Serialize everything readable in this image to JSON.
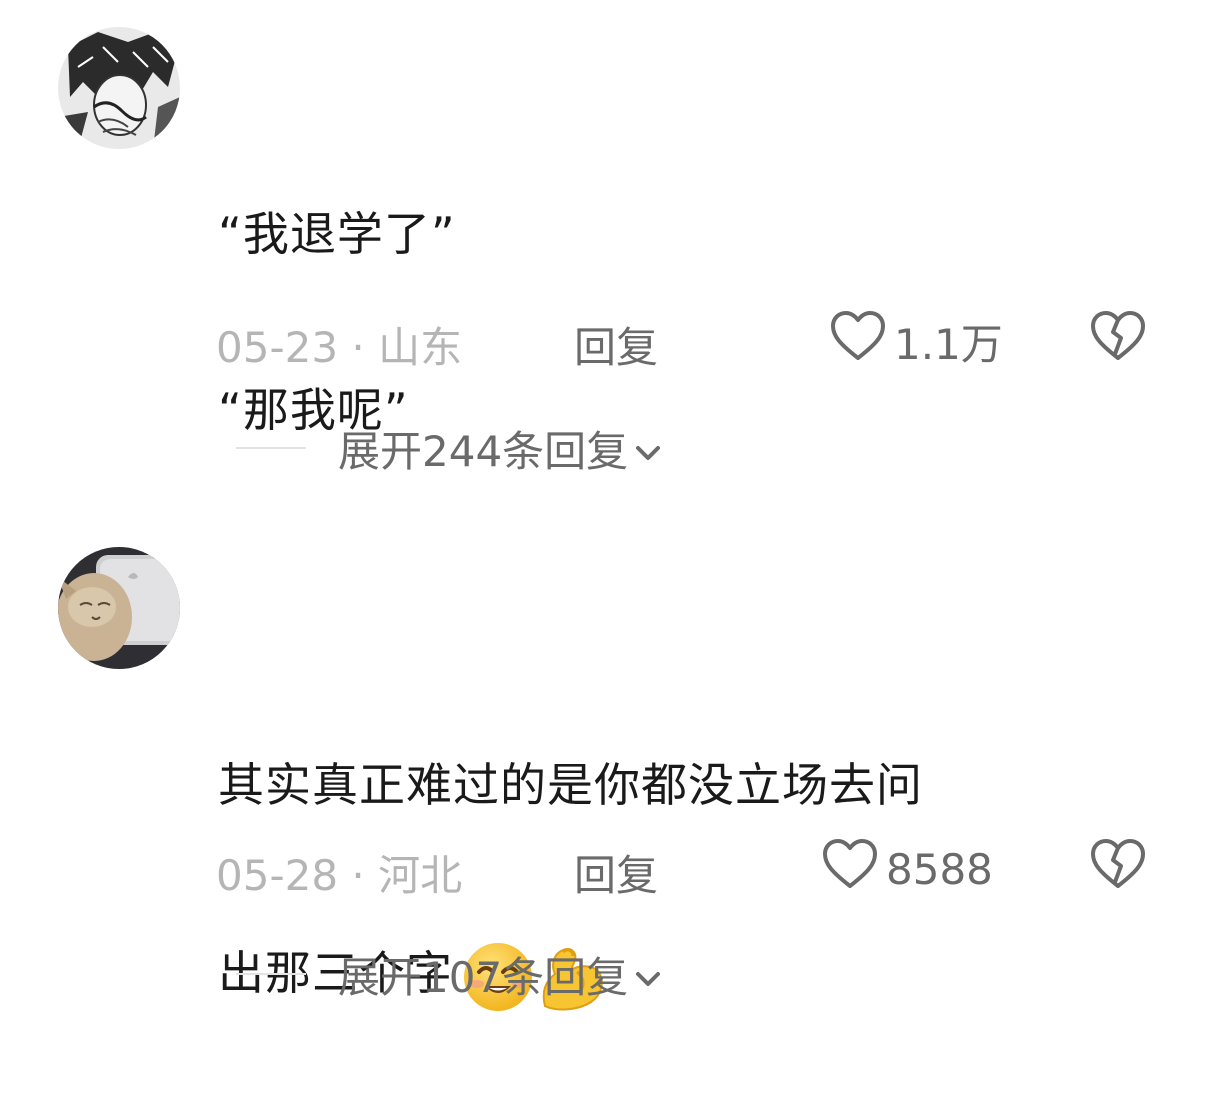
{
  "comments": [
    {
      "text_lines": [
        "“我退学了”",
        "“那我呢”"
      ],
      "date": "05-23",
      "separator": " · ",
      "location": "山东",
      "reply_label": "回复",
      "likes": "1.1万",
      "expand_label": "展开244条回复"
    },
    {
      "text_lines": [
        "其实真正难过的是你都没立场去问",
        "出那三个字"
      ],
      "emojis": [
        "smiling-face-icon",
        "flexed-biceps-icon"
      ],
      "date": "05-28",
      "separator": " · ",
      "location": "河北",
      "reply_label": "回复",
      "likes": "8588",
      "expand_label": "展开107条回复"
    }
  ],
  "colors": {
    "text": "#1a1a1a",
    "meta": "#b5b5b5",
    "action": "#6a6a6a",
    "divider": "#e3e3e3",
    "emoji_yellow": "#f7c531"
  }
}
